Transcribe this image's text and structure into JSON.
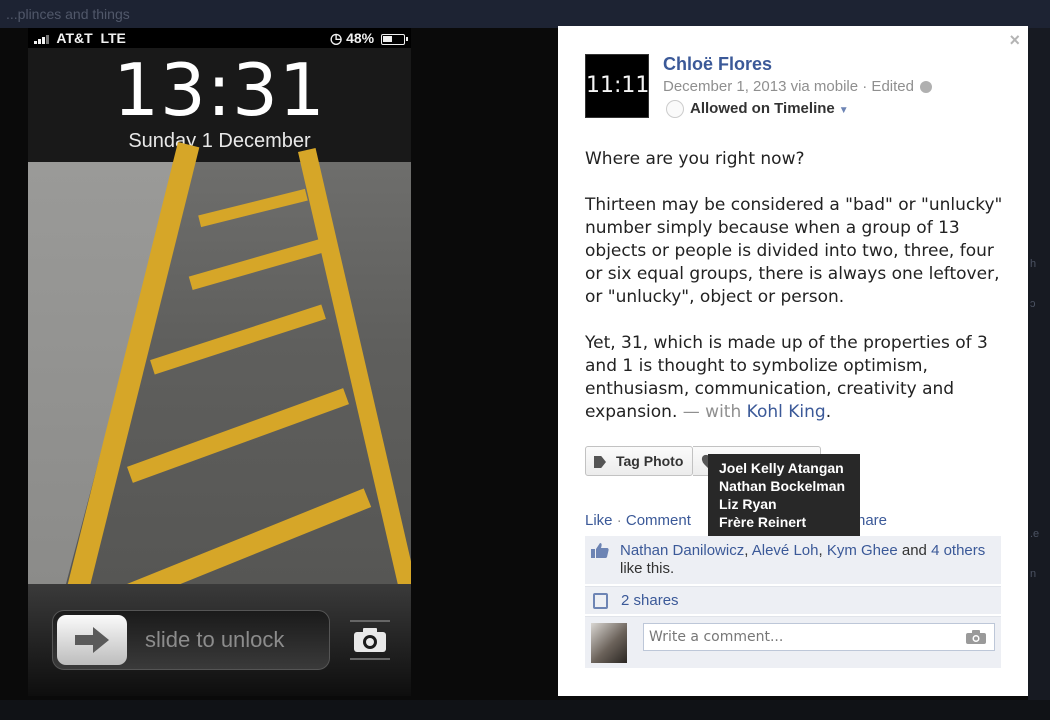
{
  "background": {
    "top_text": "...plinces and things"
  },
  "photo": {
    "status": {
      "carrier": "AT&T",
      "network": "LTE",
      "battery": "48%",
      "battery_level": 0.48
    },
    "clock": {
      "time": "13:31",
      "date": "Sunday 1 December"
    },
    "slide_label": "slide to unlock"
  },
  "post": {
    "avatar_text": "11:11",
    "author": "Chloë Flores",
    "meta": "December 1, 2013 via mobile · Edited",
    "timeline_label": "Allowed on Timeline",
    "paragraphs": [
      "Where are you right now?",
      "Thirteen may be considered a \"bad\" or \"unlucky\" number simply because when a group of 13 objects or people is divided into two, three, four or six equal groups, there is always one leftover, or \"unlucky\", object or person.",
      "Yet, 31, which is made up of the properties of 3 and 1 is thought to symbolize optimism, enthusiasm, communication, creativity and expansion."
    ],
    "with_text": "— with",
    "tagged": "Kohl King",
    "tagged_suffix": "."
  },
  "buttons": {
    "tag_photo": "Tag Photo"
  },
  "tooltip": {
    "names": [
      "Joel Kelly Atangan",
      "Nathan Bockelman",
      "Liz Ryan",
      "Frère Reinert"
    ]
  },
  "actions": {
    "like": "Like",
    "comment": "Comment",
    "share_tail": "hare"
  },
  "likes": {
    "people": [
      "Nathan Danilowicz",
      "Alevé Loh",
      "Kym Ghee"
    ],
    "and": "and",
    "others": "4 others",
    "suffix": "like this."
  },
  "shares": {
    "label": "2 shares"
  },
  "comment": {
    "placeholder": "Write a comment..."
  },
  "icons": {
    "close": "close-icon",
    "globe": "globe-icon",
    "tag": "tag-icon",
    "pin": "location-pin-icon",
    "thumb": "thumbs-up-icon",
    "share": "share-icon",
    "camera": "camera-icon"
  },
  "colors": {
    "link": "#3b5998",
    "meta": "#8f8f8f",
    "road_stripe": "#d6a628"
  }
}
